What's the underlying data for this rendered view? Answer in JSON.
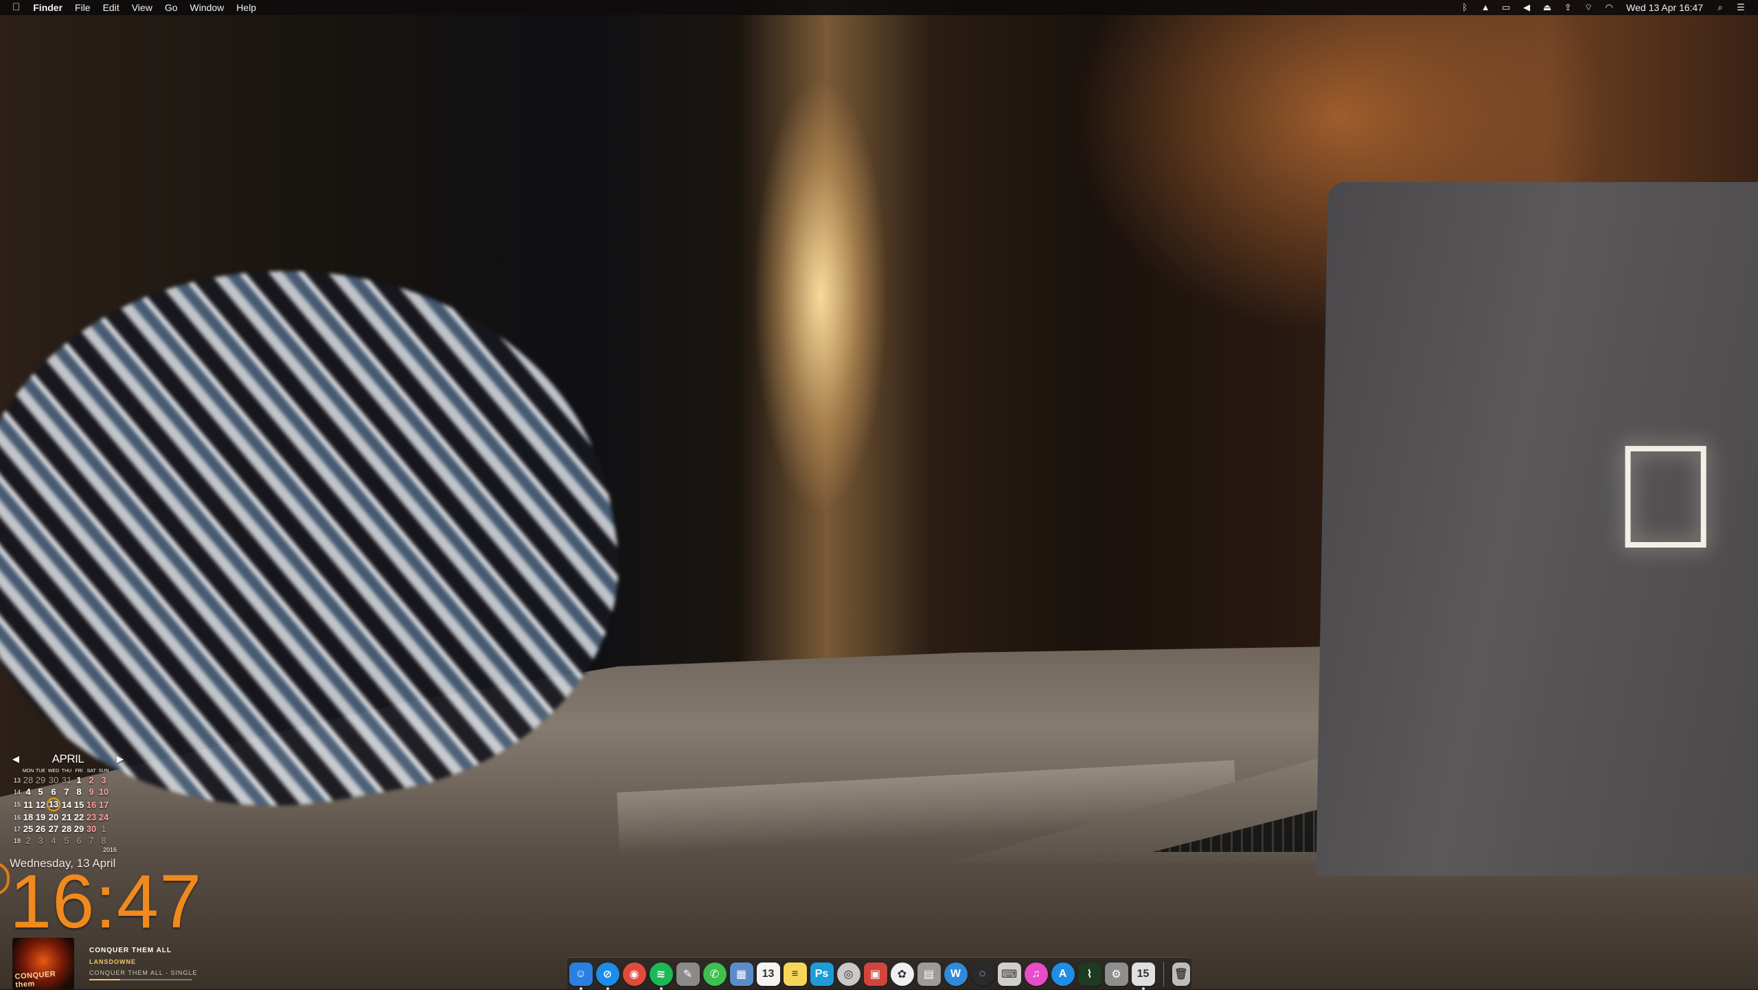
{
  "menubar": {
    "apple": "",
    "app_name": "Finder",
    "menus": [
      "File",
      "Edit",
      "View",
      "Go",
      "Window",
      "Help"
    ],
    "status_icons": [
      "bluetooth-icon",
      "drive-icon",
      "airplay-icon",
      "volume-icon",
      "eject-icon",
      "upload-icon",
      "network-icon",
      "wifi-icon"
    ],
    "clock": "Wed 13 Apr  16:47"
  },
  "calendar": {
    "month": "APRIL",
    "prev": "◀",
    "next": "▶",
    "weekdays": [
      "MON",
      "TUE",
      "WED",
      "THU",
      "FRI",
      "SAT",
      "SUN"
    ],
    "weeks": [
      {
        "wk": "13",
        "days": [
          "28",
          "29",
          "30",
          "31",
          "1",
          "2",
          "3"
        ]
      },
      {
        "wk": "14",
        "days": [
          "4",
          "5",
          "6",
          "7",
          "8",
          "9",
          "10"
        ]
      },
      {
        "wk": "15",
        "days": [
          "11",
          "12",
          "13",
          "14",
          "15",
          "16",
          "17"
        ]
      },
      {
        "wk": "16",
        "days": [
          "18",
          "19",
          "20",
          "21",
          "22",
          "23",
          "24"
        ]
      },
      {
        "wk": "17",
        "days": [
          "25",
          "26",
          "27",
          "28",
          "29",
          "30",
          "1"
        ]
      },
      {
        "wk": "18",
        "days": [
          "2",
          "3",
          "4",
          "5",
          "6",
          "7",
          "8"
        ]
      }
    ],
    "today": "13",
    "year": "2016"
  },
  "datetime": {
    "date": "Wednesday,  13  April",
    "time": "16:47"
  },
  "nowplaying": {
    "album_art_text": "CONQUER them",
    "title": "CONQUER THEM ALL",
    "artist": "LANSDOWNE",
    "album": "CONQUER THEM ALL - SINGLE",
    "progress": 0.3
  },
  "dock": {
    "apps": [
      {
        "name": "finder-icon",
        "glyph": "☺",
        "color": "#2a7fe0",
        "running": true
      },
      {
        "name": "safari-icon",
        "glyph": "⊘",
        "color": "#1e8ce8",
        "running": true
      },
      {
        "name": "chrome-icon",
        "glyph": "◉",
        "color": "#e14b3b",
        "running": false
      },
      {
        "name": "spotify-icon",
        "glyph": "≋",
        "color": "#1db954",
        "running": true
      },
      {
        "name": "script-editor-icon",
        "glyph": "✎",
        "color": "#8a8a8a",
        "running": false
      },
      {
        "name": "messages-icon",
        "glyph": "✆",
        "color": "#3fbf4e",
        "running": false
      },
      {
        "name": "preview-icon",
        "glyph": "▦",
        "color": "#5b8cc8",
        "running": false
      },
      {
        "name": "calendar-icon",
        "glyph": "13",
        "color": "#f4f4f4",
        "running": false
      },
      {
        "name": "notes-icon",
        "glyph": "≡",
        "color": "#f6d65a",
        "running": false
      },
      {
        "name": "photoshop-icon",
        "glyph": "Ps",
        "color": "#1d9cd8",
        "running": false
      },
      {
        "name": "photo-booth-icon",
        "glyph": "◎",
        "color": "#c9c9c9",
        "running": false
      },
      {
        "name": "mosaic-app-icon",
        "glyph": "▣",
        "color": "#d0463c",
        "running": false
      },
      {
        "name": "photos-icon",
        "glyph": "✿",
        "color": "#f0f0f0",
        "running": false
      },
      {
        "name": "archive-icon",
        "glyph": "▤",
        "color": "#9b9b9b",
        "running": false
      },
      {
        "name": "word-icon",
        "glyph": "W",
        "color": "#2f8ad9",
        "running": false
      },
      {
        "name": "utility-icon",
        "glyph": "◌",
        "color": "#2a2a2a",
        "running": false
      },
      {
        "name": "keyboard-icon",
        "glyph": "⌨",
        "color": "#cfcfcf",
        "running": false
      },
      {
        "name": "itunes-icon",
        "glyph": "♫",
        "color": "#e94cc8",
        "running": false
      },
      {
        "name": "app-store-icon",
        "glyph": "A",
        "color": "#1f8ee6",
        "running": false
      },
      {
        "name": "activity-monitor-icon",
        "glyph": "⌇",
        "color": "#1f3a22",
        "running": false
      },
      {
        "name": "system-preferences-icon",
        "glyph": "⚙",
        "color": "#8e8e8e",
        "running": false
      },
      {
        "name": "calendar-widget-icon",
        "glyph": "15",
        "color": "#e0e0e0",
        "running": true
      }
    ],
    "trash": {
      "name": "trash-icon",
      "glyph": "🗑",
      "color": "#bdbdbd"
    }
  }
}
